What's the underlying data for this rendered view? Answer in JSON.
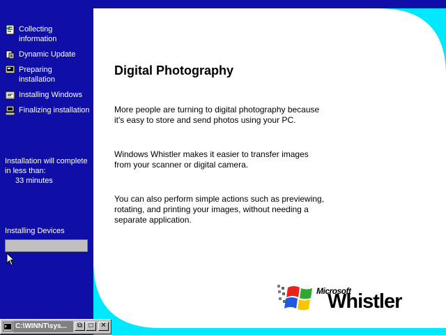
{
  "sidebar": {
    "steps": [
      {
        "label": "Collecting\ninformation",
        "icon": "checklist-icon"
      },
      {
        "label": "Dynamic Update",
        "icon": "document-update-icon"
      },
      {
        "label": "Preparing\ninstallation",
        "icon": "monitor-icon"
      },
      {
        "label": "Installing Windows",
        "icon": "install-icon"
      },
      {
        "label": "Finalizing installation",
        "icon": "computer-icon"
      }
    ],
    "estimate": {
      "line1": "Installation will complete",
      "line2": "in less than:",
      "minutes": "33 minutes"
    },
    "progress": {
      "label": "Installing Devices",
      "percent": 0
    }
  },
  "content": {
    "title": "Digital Photography",
    "paragraphs": [
      "More people are turning to digital photography because\nit's easy to store and send photos using your PC.",
      "Windows Whistler makes it easier to transfer images\nfrom your scanner or digital camera.",
      "You can also perform simple actions such as previewing,\nrotating, and printing your images, without needing a\nseparate application."
    ]
  },
  "logo": {
    "microsoft": "Microsoft",
    "product": "Whistler"
  },
  "taskbar": {
    "window_title": "C:\\WINNT\\sys...",
    "restore": "⧉",
    "maximize": "□",
    "close": "✕"
  },
  "colors": {
    "background": "#0f0fa8",
    "accent": "#00e8ff",
    "panel": "#ffffff"
  }
}
